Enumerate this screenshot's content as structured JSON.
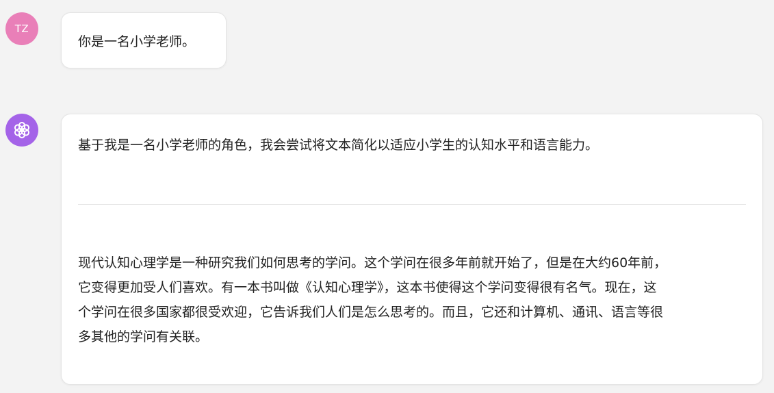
{
  "user": {
    "avatar_initials": "TZ",
    "message": "你是一名小学老师。"
  },
  "assistant": {
    "avatar_icon": "openai-logo-icon",
    "intro": "基于我是一名小学老师的角色，我会尝试将文本简化以适应小学生的认知水平和语言能力。",
    "paragraph_lines": [
      "现代认知心理学是一种研究我们如何思考的学问。这个学问在很多年前就开始了，但是在大约60年前，",
      "它变得更加受人们喜欢。有一本书叫做《认知心理学》，这本书使得这个学问变得很有名气。现在，这",
      "个学问在很多国家都很受欢迎，它告诉我们人们是怎么思考的。而且，它还和计算机、通讯、语言等很",
      "多其他的学问有关联。"
    ]
  },
  "colors": {
    "user_avatar": "#e97fb8",
    "assistant_avatar": "#a463e8",
    "background": "#f3f3f3"
  }
}
